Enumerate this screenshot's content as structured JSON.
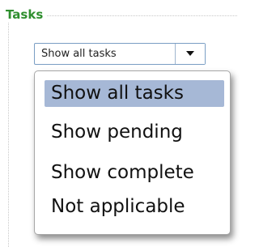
{
  "group": {
    "legend": "Tasks"
  },
  "filter_select": {
    "selected": "Show all tasks",
    "arrow_icon": "dropdown-arrow-icon"
  },
  "menu": {
    "options": [
      "Show all tasks",
      "Show pending",
      "Show complete",
      "Not applicable"
    ],
    "selected_index": 0,
    "highlight_color": "#a6b8d6"
  },
  "colors": {
    "legend": "#2f8f2f",
    "select_border": "#7a9ec4"
  }
}
